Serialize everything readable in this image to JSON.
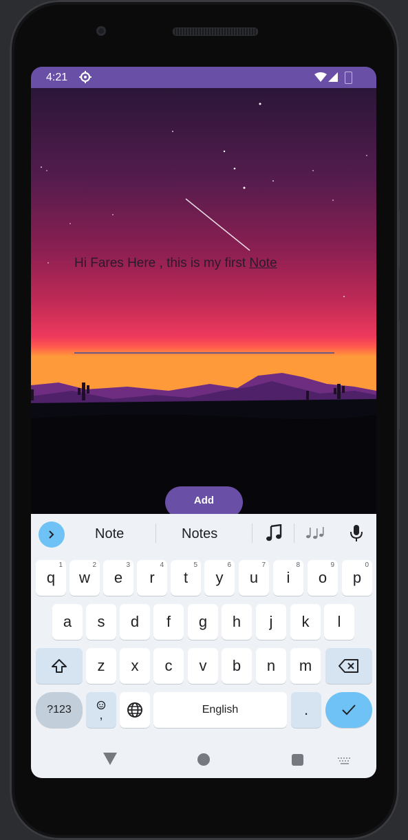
{
  "status_bar": {
    "time": "4:21",
    "icons": [
      "settings-icon",
      "wifi-icon",
      "cell-signal-icon",
      "battery-icon"
    ]
  },
  "note": {
    "text_before": "Hi Fares Here , this is my first ",
    "text_underlined": "Note"
  },
  "add_button": {
    "label": "Add"
  },
  "keyboard": {
    "suggestions": [
      "Note",
      "Notes"
    ],
    "row1": [
      {
        "key": "q",
        "hint": "1"
      },
      {
        "key": "w",
        "hint": "2"
      },
      {
        "key": "e",
        "hint": "3"
      },
      {
        "key": "r",
        "hint": "4"
      },
      {
        "key": "t",
        "hint": "5"
      },
      {
        "key": "y",
        "hint": "6"
      },
      {
        "key": "u",
        "hint": "7"
      },
      {
        "key": "i",
        "hint": "8"
      },
      {
        "key": "o",
        "hint": "9"
      },
      {
        "key": "p",
        "hint": "0"
      }
    ],
    "row2": [
      "a",
      "s",
      "d",
      "f",
      "g",
      "h",
      "j",
      "k",
      "l"
    ],
    "row3": [
      "z",
      "x",
      "c",
      "v",
      "b",
      "n",
      "m"
    ],
    "mode_label": "?123",
    "emoji_comma_label": ",",
    "space_label": "English",
    "period_label": "."
  },
  "colors": {
    "accent": "#6a4fa6",
    "enter_key": "#6fc2f5",
    "keyboard_bg": "#eef1f5"
  }
}
